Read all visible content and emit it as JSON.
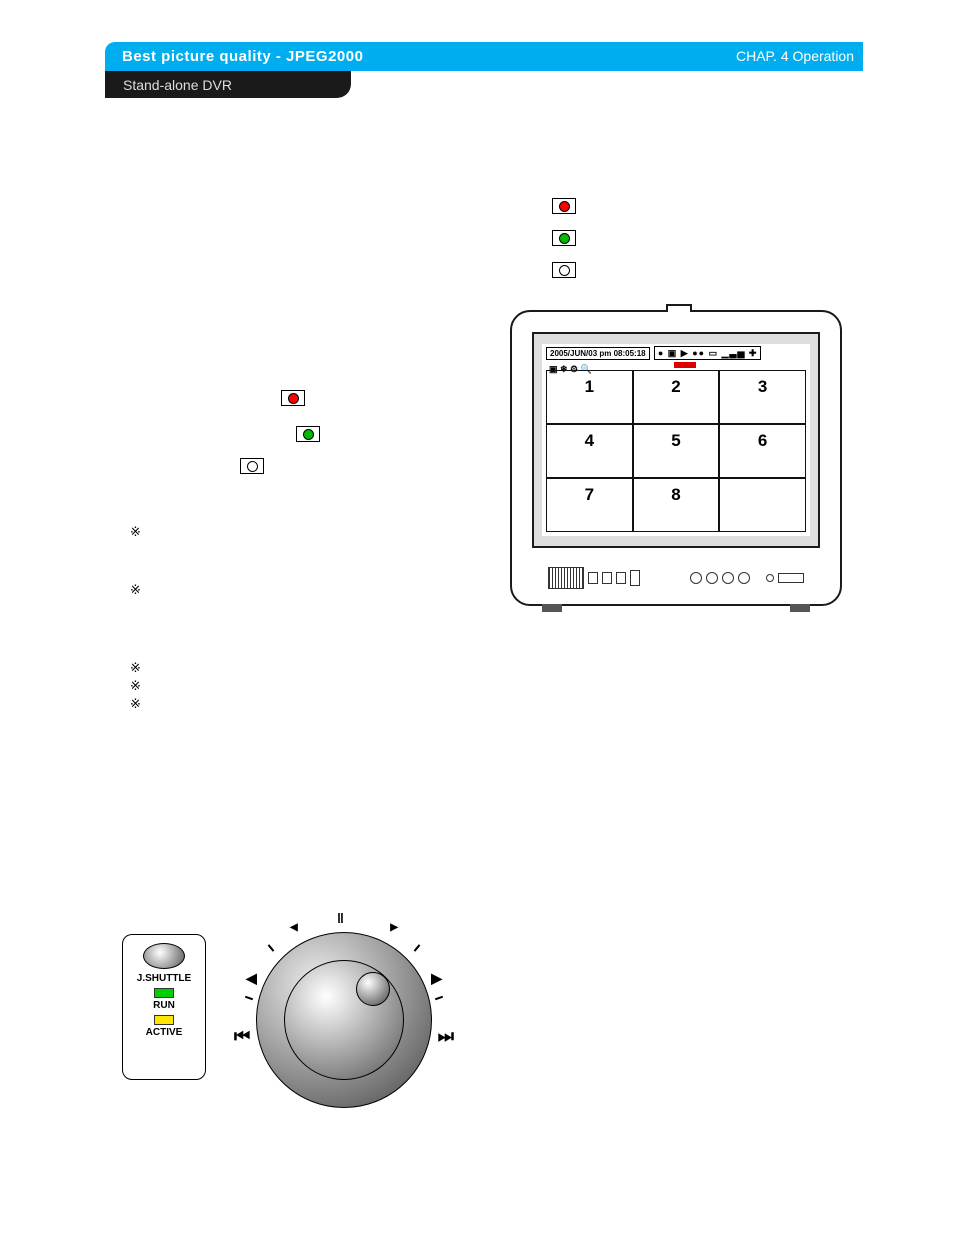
{
  "header": {
    "title_prefix": "Best picture quality",
    "sep": " - ",
    "title_suffix": "JPEG2000",
    "subtitle": "Stand-alone DVR",
    "chapter": "CHAP. 4  Operation"
  },
  "legend_right": {
    "red_label": "",
    "green_label": "",
    "white_label": ""
  },
  "legend_left": {
    "red": "",
    "green": "",
    "white": ""
  },
  "bullets": {
    "b1": "※",
    "b2": "※",
    "b3": "※",
    "b4": "※",
    "b5": "※"
  },
  "monitor": {
    "datetime": "2005/JUN/03 pm 08:05:18",
    "cells": [
      "1",
      "2",
      "3",
      "4",
      "5",
      "6",
      "7",
      "8",
      ""
    ],
    "topbar_icons": "▣ ❄ ⚙ 🔍",
    "status_icons": "● ▣ ▶ ●● ▭ ▁▃▅ ✚"
  },
  "panel": {
    "title": "J.SHUTTLE",
    "run": "RUN",
    "active": "ACTIVE",
    "run_color": "#00d000",
    "active_color": "#ffe400"
  },
  "wheel_ticks": [
    "‖",
    "◀",
    "◀",
    "▶",
    "▶"
  ]
}
